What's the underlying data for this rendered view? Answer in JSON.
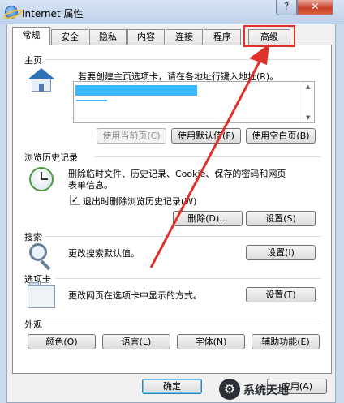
{
  "window": {
    "title": "Internet 属性",
    "help_button": "?",
    "close_button": "✕"
  },
  "tabs": [
    {
      "label": "常规",
      "active": true
    },
    {
      "label": "安全"
    },
    {
      "label": "隐私"
    },
    {
      "label": "内容"
    },
    {
      "label": "连接"
    },
    {
      "label": "程序"
    },
    {
      "label": "高级"
    }
  ],
  "homepage": {
    "group_title": "主页",
    "description": "若要创建主页选项卡，请在各地址行键入地址(R)。",
    "use_current": "使用当前页(C)",
    "use_default": "使用默认值(F)",
    "use_blank": "使用空白页(B)"
  },
  "history": {
    "group_title": "浏览历史记录",
    "description_line1": "删除临时文件、历史记录、Cookie、保存的密码和网页",
    "description_line2": "表单信息。",
    "delete_on_exit_label": "退出时删除浏览历史记录(W)",
    "delete_on_exit_checked": true,
    "delete_button": "删除(D)...",
    "settings_button": "设置(S)"
  },
  "search": {
    "group_title": "搜索",
    "description": "更改搜索默认值。",
    "settings_button": "设置(I)"
  },
  "tab_settings": {
    "group_title": "选项卡",
    "description": "更改网页在选项卡中显示的方式。",
    "settings_button": "设置(T)"
  },
  "appearance": {
    "group_title": "外观",
    "colors_button": "颜色(O)",
    "languages_button": "语言(L)",
    "fonts_button": "字体(N)",
    "accessibility_button": "辅助功能(E)"
  },
  "dialog_buttons": {
    "ok": "确定",
    "apply": "应用(A)"
  },
  "watermark": {
    "text": "系统天地"
  },
  "colors": {
    "annotation_red": "#e0312a",
    "selection_blue": "#3bb6ff"
  }
}
